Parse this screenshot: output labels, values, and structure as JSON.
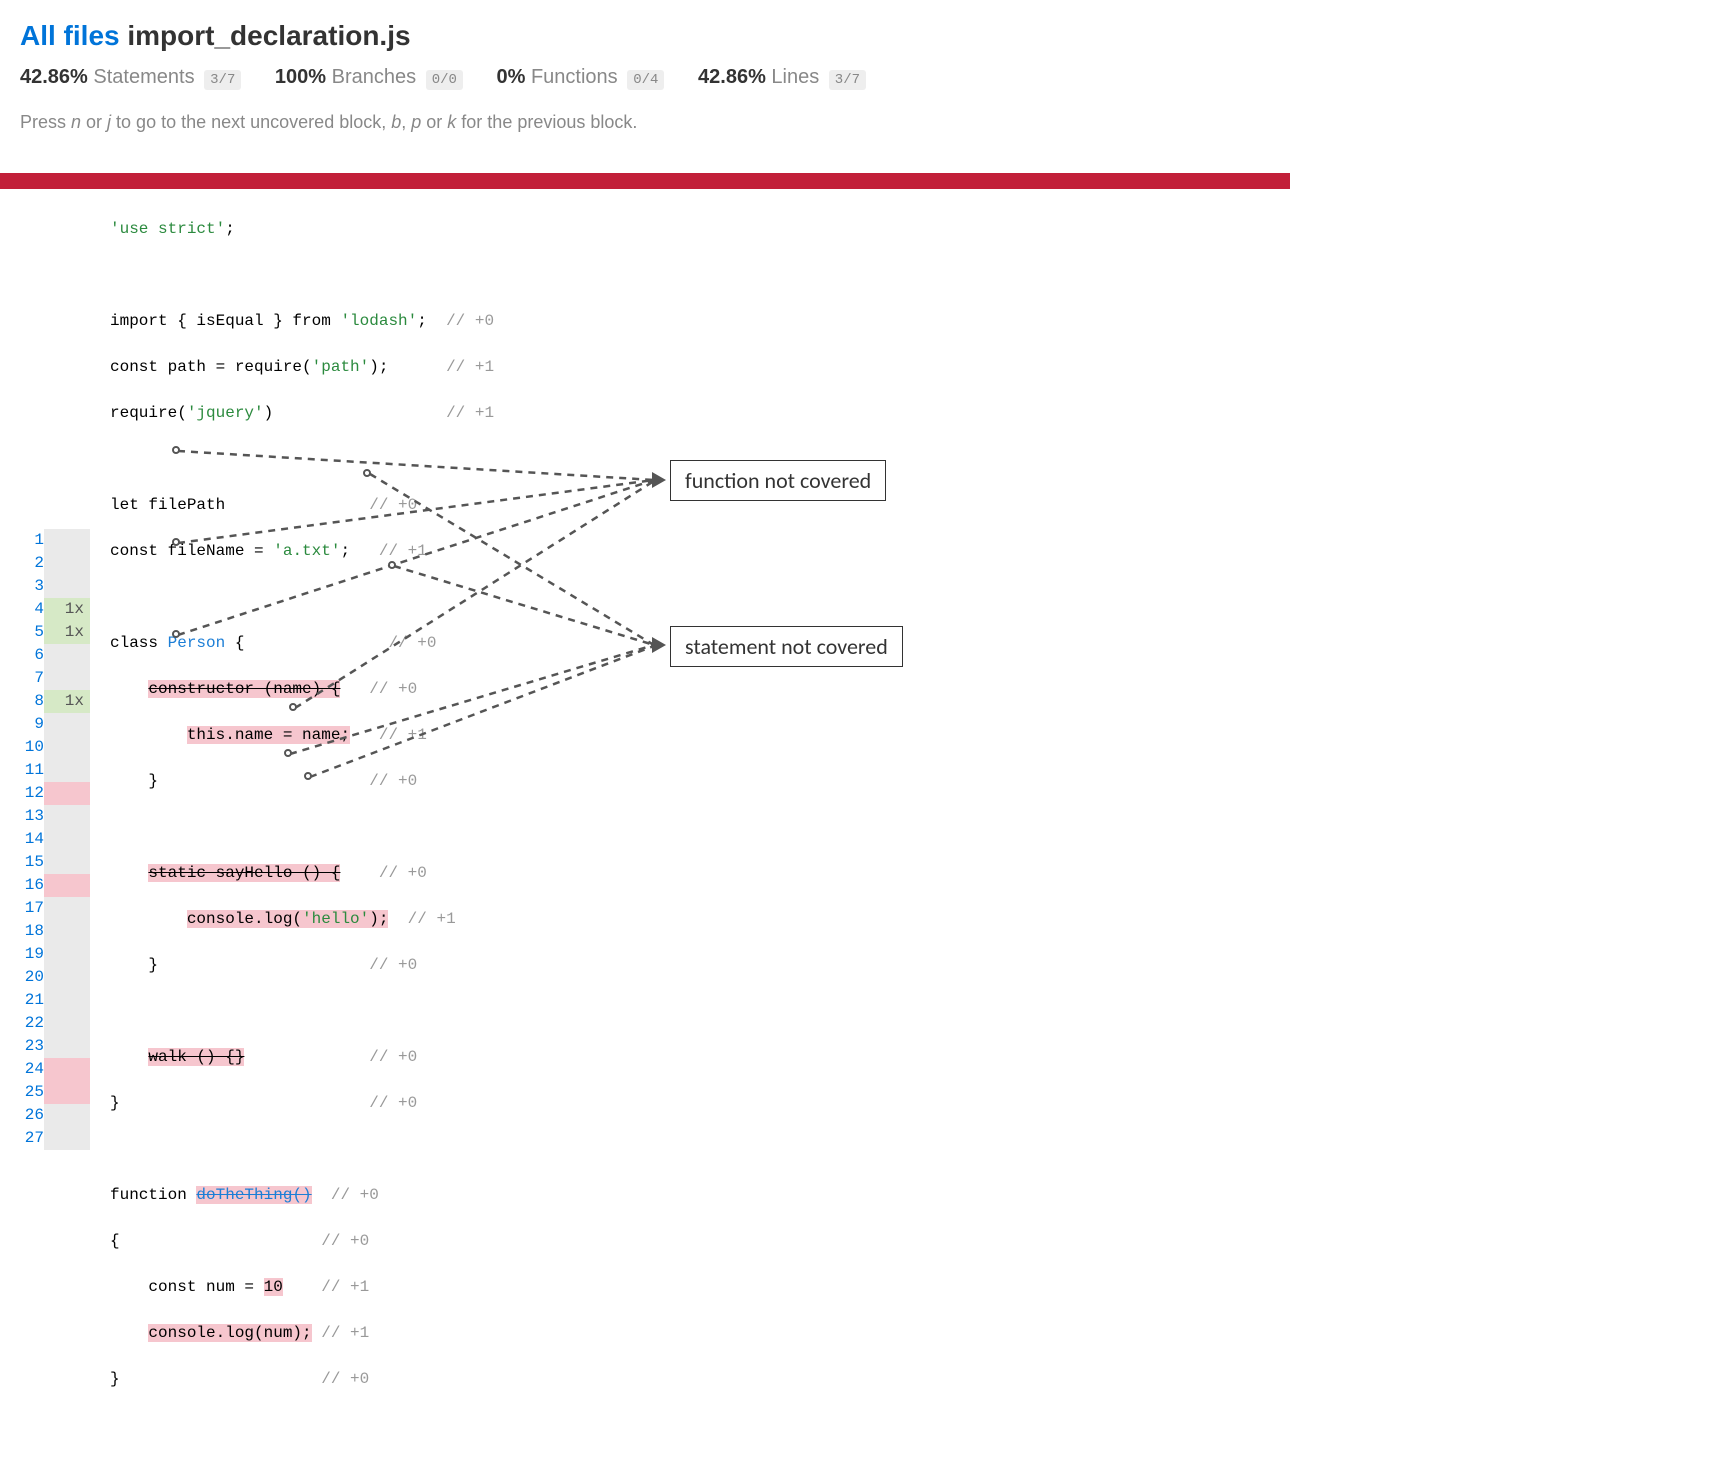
{
  "breadcrumb": {
    "root": "All files",
    "file": "import_declaration.js"
  },
  "stats": {
    "statements": {
      "pct": "42.86%",
      "label": "Statements",
      "frac": "3/7"
    },
    "branches": {
      "pct": "100%",
      "label": "Branches",
      "frac": "0/0"
    },
    "functions": {
      "pct": "0%",
      "label": "Functions",
      "frac": "0/4"
    },
    "lines": {
      "pct": "42.86%",
      "label": "Lines",
      "frac": "3/7"
    }
  },
  "hint": {
    "t0": "Press ",
    "n": "n",
    "t1": " or ",
    "j": "j",
    "t2": " to go to the next uncovered block, ",
    "b": "b",
    "t3": ", ",
    "p": "p",
    "t4": " or ",
    "k": "k",
    "t5": " for the previous block."
  },
  "annotations": {
    "fn": "function not covered",
    "st": "statement not covered"
  },
  "lines": {
    "1": {
      "n": "1",
      "cnt": "",
      "hit": "none"
    },
    "2": {
      "n": "2",
      "cnt": "",
      "hit": "none"
    },
    "3": {
      "n": "3",
      "cnt": "",
      "hit": "none"
    },
    "4": {
      "n": "4",
      "cnt": "1x",
      "hit": "hit"
    },
    "5": {
      "n": "5",
      "cnt": "1x",
      "hit": "hit"
    },
    "6": {
      "n": "6",
      "cnt": "",
      "hit": "none"
    },
    "7": {
      "n": "7",
      "cnt": "",
      "hit": "none"
    },
    "8": {
      "n": "8",
      "cnt": "1x",
      "hit": "hit"
    },
    "9": {
      "n": "9",
      "cnt": "",
      "hit": "none"
    },
    "10": {
      "n": "10",
      "cnt": "",
      "hit": "none"
    },
    "11": {
      "n": "11",
      "cnt": "",
      "hit": "none"
    },
    "12": {
      "n": "12",
      "cnt": "",
      "hit": "miss"
    },
    "13": {
      "n": "13",
      "cnt": "",
      "hit": "none"
    },
    "14": {
      "n": "14",
      "cnt": "",
      "hit": "none"
    },
    "15": {
      "n": "15",
      "cnt": "",
      "hit": "none"
    },
    "16": {
      "n": "16",
      "cnt": "",
      "hit": "miss"
    },
    "17": {
      "n": "17",
      "cnt": "",
      "hit": "none"
    },
    "18": {
      "n": "18",
      "cnt": "",
      "hit": "none"
    },
    "19": {
      "n": "19",
      "cnt": "",
      "hit": "none"
    },
    "20": {
      "n": "20",
      "cnt": "",
      "hit": "none"
    },
    "21": {
      "n": "21",
      "cnt": "",
      "hit": "none"
    },
    "22": {
      "n": "22",
      "cnt": "",
      "hit": "none"
    },
    "23": {
      "n": "23",
      "cnt": "",
      "hit": "none"
    },
    "24": {
      "n": "24",
      "cnt": "",
      "hit": "miss"
    },
    "25": {
      "n": "25",
      "cnt": "",
      "hit": "miss"
    },
    "26": {
      "n": "26",
      "cnt": "",
      "hit": "none"
    },
    "27": {
      "n": "27",
      "cnt": "",
      "hit": "none"
    }
  },
  "src": {
    "l1_str": "'use strict'",
    "l1_end": ";",
    "l3_a": "import { isEqual } from ",
    "l3_str": "'lodash'",
    "l3_b": ";  ",
    "l3_c": "// +0",
    "l4_a": "const path = require(",
    "l4_str": "'path'",
    "l4_b": ");      ",
    "l4_c": "// +1",
    "l5_a": "require(",
    "l5_str": "'jquery'",
    "l5_b": ")                  ",
    "l5_c": "// +1",
    "l7_a": "let filePath               ",
    "l7_c": "// +0",
    "l8_a": "const fileName = ",
    "l8_str": "'a.txt'",
    "l8_b": ";   ",
    "l8_c": "// +1",
    "l10_a": "class ",
    "l10_cls": "Person",
    "l10_b": " {               ",
    "l10_c": "// +0",
    "l11_ind": "    ",
    "l11_miss": "constructor (name) {",
    "l11_sp": "   ",
    "l11_c": "// +0",
    "l12_ind": "        ",
    "l12_miss": "this.name = name;",
    "l12_sp": "   ",
    "l12_c": "// +1",
    "l13_a": "    }                      ",
    "l13_c": "// +0",
    "l15_ind": "    ",
    "l15_miss_a": "st",
    "l15_miss_b": "atic sayHello () {",
    "l15_sp": "    ",
    "l15_c": "// +0",
    "l16_ind": "        ",
    "l16_miss_a": "console.log(",
    "l16_miss_str": "'hello'",
    "l16_miss_b": ");",
    "l16_sp": "  ",
    "l16_c": "// +1",
    "l17_a": "    }                      ",
    "l17_c": "// +0",
    "l19_ind": "    ",
    "l19_miss": "walk () {}",
    "l19_sp": "             ",
    "l19_c": "// +0",
    "l20_a": "}                          ",
    "l20_c": "// +0",
    "l22_a": "function ",
    "l22_miss": "doTheThing()",
    "l22_sp": "  ",
    "l22_c": "// +0",
    "l23_a": "{                     ",
    "l23_c": "// +0",
    "l24_ind": "    ",
    "l24_a": "const num = ",
    "l24_miss": "10",
    "l24_sp": "    ",
    "l24_c": "// +1",
    "l25_ind": "    ",
    "l25_miss": "console.log(num);",
    "l25_sp": " ",
    "l25_c": "// +1",
    "l26_a": "}                     ",
    "l26_c": "// +0"
  }
}
